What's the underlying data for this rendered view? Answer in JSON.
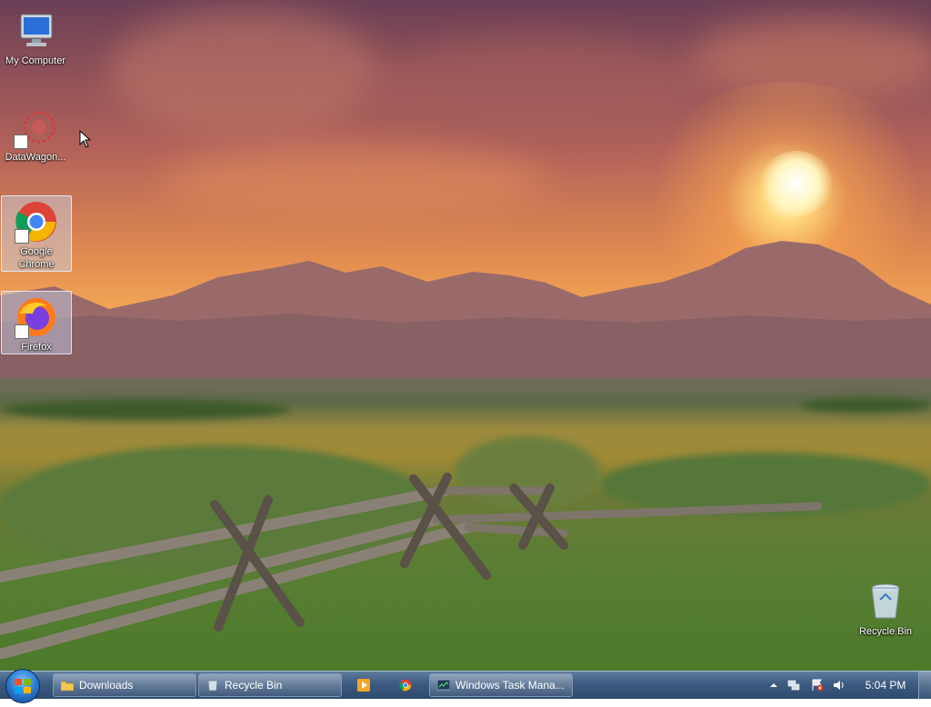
{
  "desktop": {
    "icons": [
      {
        "label": "My Computer",
        "icon": "computer-icon"
      },
      {
        "label": "DataWagon...",
        "icon": "datawagon-icon"
      },
      {
        "label_line1": "Google",
        "label_line2": "Chrome",
        "icon": "chrome-icon"
      },
      {
        "label": "Firefox",
        "icon": "firefox-icon"
      },
      {
        "label": "Recycle Bin",
        "icon": "recycle-bin-icon"
      }
    ]
  },
  "taskbar": {
    "start_icon": "windows-logo-icon",
    "buttons": [
      {
        "label": "Downloads",
        "icon": "folder-icon"
      },
      {
        "label": "Recycle Bin",
        "icon": "recycle-bin-icon"
      },
      {
        "label": "",
        "icon": "media-player-icon"
      },
      {
        "label": "",
        "icon": "chrome-icon"
      },
      {
        "label": "Windows Task Mana...",
        "icon": "task-manager-icon"
      }
    ],
    "tray": {
      "icons": [
        "show-hidden-icons-icon",
        "network-icon",
        "action-center-icon",
        "volume-icon"
      ],
      "clock": "5:04 PM"
    }
  }
}
